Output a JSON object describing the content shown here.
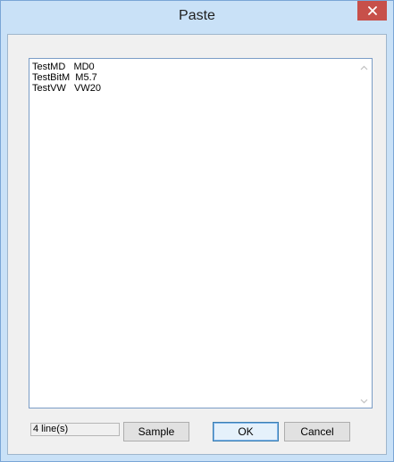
{
  "window": {
    "title": "Paste",
    "close_icon": "close-icon"
  },
  "editor": {
    "lines": [
      "TestMD   MD0",
      "TestBitM  M5.7",
      "TestVW   VW20"
    ],
    "scroll_up_icon": "chevron-up-icon",
    "scroll_down_icon": "chevron-down-icon"
  },
  "footer": {
    "status_text": "4 line(s)",
    "sample_label": "Sample",
    "ok_label": "OK",
    "cancel_label": "Cancel"
  },
  "colors": {
    "titlebar": "#c9e1f7",
    "close_button": "#c7504a",
    "client_bg": "#f0f0f0"
  }
}
